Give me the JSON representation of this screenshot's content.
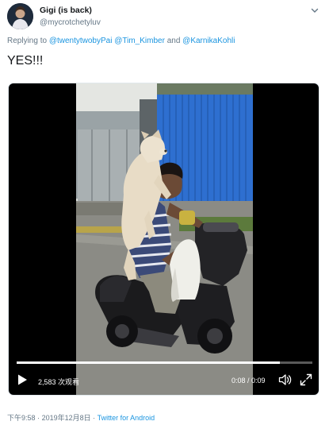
{
  "tweet": {
    "display_name": "Gigi (is back)",
    "handle": "@mycrotchetyluv",
    "replying_prefix": "Replying to",
    "mentions": [
      "@twentytwobyPai",
      "@Tim_Kimber",
      "@KarnikaKohli"
    ],
    "mentions_joiner": "and",
    "text": "YES!!!",
    "time": "下午9:58",
    "date": "2019年12月8日",
    "meta_separator": "·",
    "source": "Twitter for Android"
  },
  "video": {
    "view_count": "2,583 次观看",
    "time_display": "0:08 / 0:09",
    "progress": 0.89,
    "scene_colors": {
      "sky": "#d9dcd8",
      "fence": "#2e6fd0",
      "road": "#8b8b85",
      "shirt_stripe": "#3b4a78",
      "dog": "#e8dcc6"
    }
  },
  "icons": [
    "user-avatar",
    "chevron-down-icon",
    "play-icon",
    "volume-icon",
    "fullscreen-icon"
  ],
  "colors": {
    "link": "#1b95e0",
    "secondary_text": "#657786",
    "primary_text": "#14171a"
  }
}
